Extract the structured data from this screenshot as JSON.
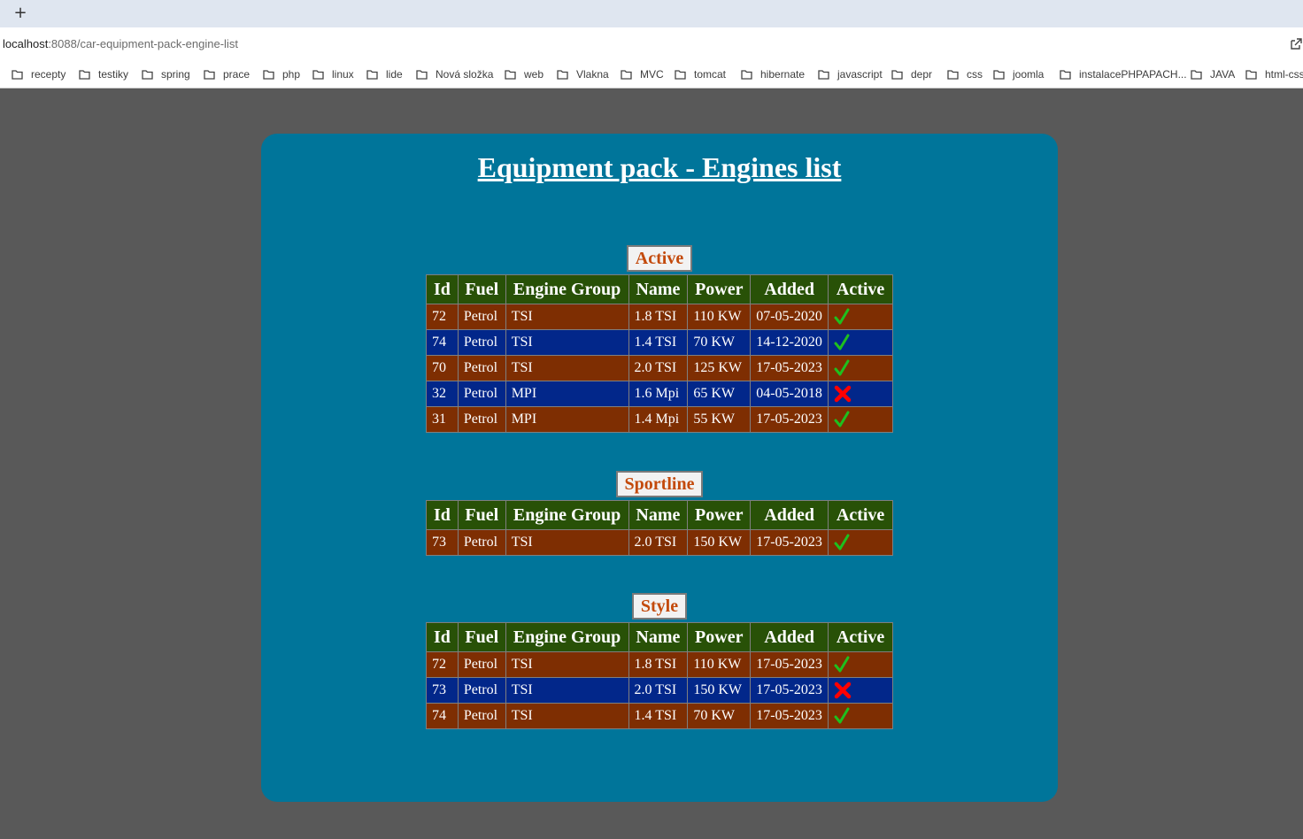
{
  "browser": {
    "url_host": "localhost",
    "url_path": ":8088/car-equipment-pack-engine-list",
    "bookmarks": [
      "recepty",
      "testiky",
      "spring",
      "prace",
      "php",
      "linux",
      "lide",
      "Nová složka",
      "web",
      "Vlakna",
      "MVC",
      "tomcat",
      "hibernate",
      "javascript",
      "depr",
      "css",
      "joomla",
      "instalacePHPAPACH...",
      "JAVA",
      "html-css"
    ]
  },
  "page": {
    "title": "Equipment pack - Engines list"
  },
  "columns": [
    "Id",
    "Fuel",
    "Engine Group",
    "Name",
    "Power",
    "Added",
    "Active"
  ],
  "sections": [
    {
      "caption": "Active",
      "rows": [
        {
          "id": "72",
          "fuel": "Petrol",
          "group": "TSI",
          "name": "1.8 TSI",
          "power": "110 KW",
          "added": "07-05-2020",
          "active": true
        },
        {
          "id": "74",
          "fuel": "Petrol",
          "group": "TSI",
          "name": "1.4 TSI",
          "power": "70 KW",
          "added": "14-12-2020",
          "active": true
        },
        {
          "id": "70",
          "fuel": "Petrol",
          "group": "TSI",
          "name": "2.0 TSI",
          "power": "125 KW",
          "added": "17-05-2023",
          "active": true
        },
        {
          "id": "32",
          "fuel": "Petrol",
          "group": "MPI",
          "name": "1.6 Mpi",
          "power": "65 KW",
          "added": "04-05-2018",
          "active": false
        },
        {
          "id": "31",
          "fuel": "Petrol",
          "group": "MPI",
          "name": "1.4 Mpi",
          "power": "55 KW",
          "added": "17-05-2023",
          "active": true
        }
      ]
    },
    {
      "caption": "Sportline",
      "rows": [
        {
          "id": "73",
          "fuel": "Petrol",
          "group": "TSI",
          "name": "2.0 TSI",
          "power": "150 KW",
          "added": "17-05-2023",
          "active": true
        }
      ]
    },
    {
      "caption": "Style",
      "rows": [
        {
          "id": "72",
          "fuel": "Petrol",
          "group": "TSI",
          "name": "1.8 TSI",
          "power": "110 KW",
          "added": "17-05-2023",
          "active": true
        },
        {
          "id": "73",
          "fuel": "Petrol",
          "group": "TSI",
          "name": "2.0 TSI",
          "power": "150 KW",
          "added": "17-05-2023",
          "active": false
        },
        {
          "id": "74",
          "fuel": "Petrol",
          "group": "TSI",
          "name": "1.4 TSI",
          "power": "70 KW",
          "added": "17-05-2023",
          "active": true
        }
      ]
    }
  ],
  "colors": {
    "page_background": "#595959",
    "card": "#00759a",
    "header_row": "#285107",
    "row_odd": "#7e2e02",
    "row_even": "#02278a",
    "caption_text": "#c34a0c",
    "check": "#1ec01e",
    "cross": "#ff0000"
  },
  "icons": {
    "active_true": "check-icon",
    "active_false": "cross-icon"
  }
}
